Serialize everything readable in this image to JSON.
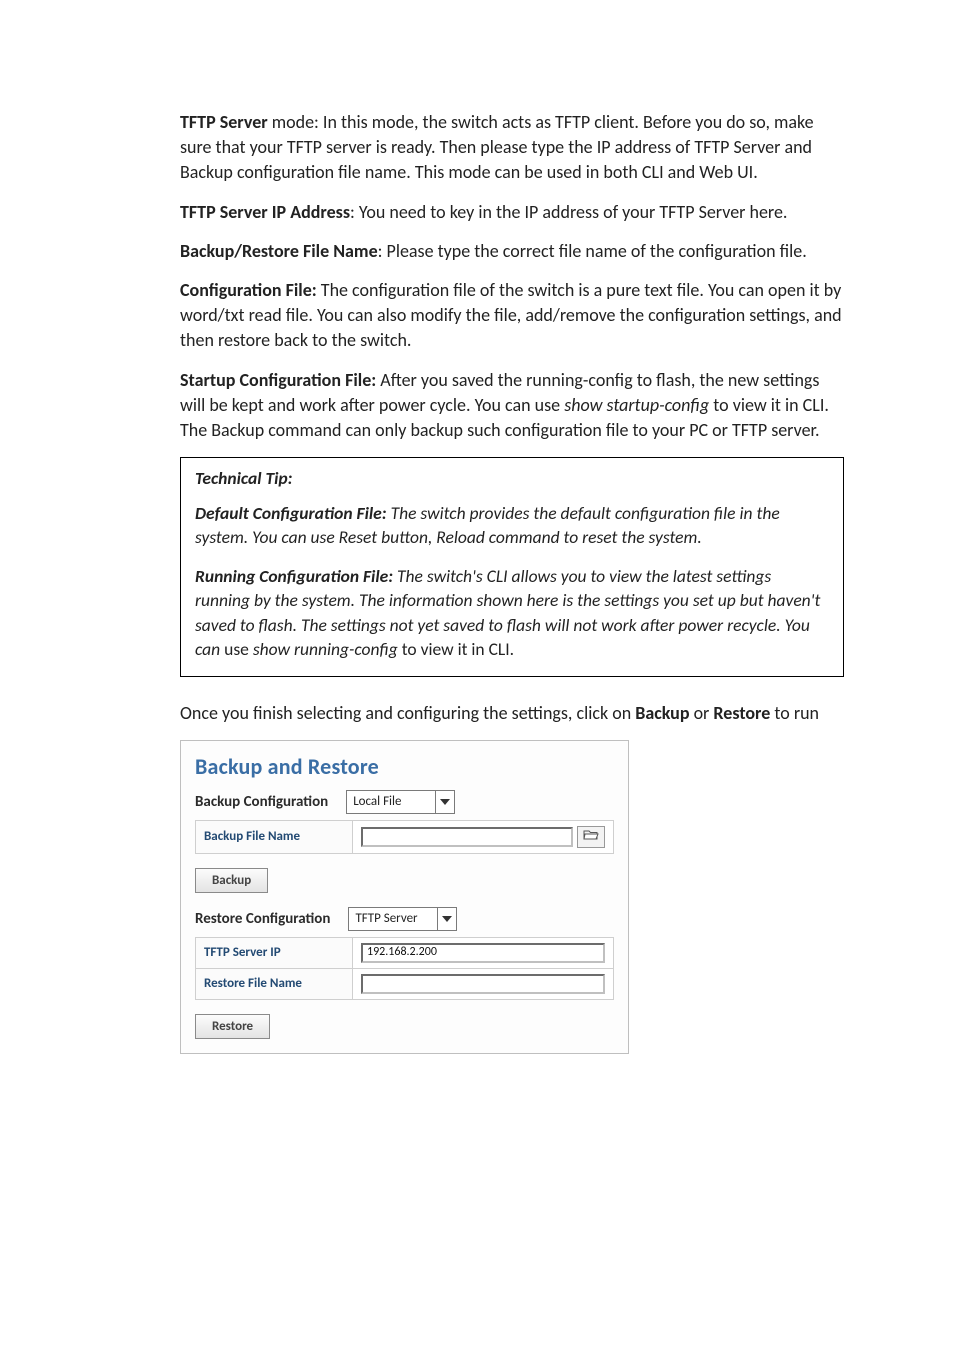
{
  "paragraphs": {
    "p1": {
      "lead": "TFTP Server",
      "rest": " mode: In this mode, the switch acts as TFTP client. Before you do so, make sure that your TFTP server is ready. Then please type the IP address of TFTP Server and Backup configuration file name. This mode can be used in both CLI and Web UI."
    },
    "p2": {
      "lead": "TFTP Server IP Address",
      "rest": ": You need to key in the IP address of your TFTP Server here."
    },
    "p3": {
      "lead": "Backup/Restore File Name",
      "rest": ": Please type the correct file name of the configuration file."
    },
    "p4": {
      "lead": "Configuration File:",
      "rest": " The configuration file of the switch is a pure text file. You can open it by word/txt read file. You can also modify the file, add/remove the configuration settings, and then restore back to the switch."
    },
    "p5": {
      "lead": "Startup Configuration File:",
      "rest1": " After you saved the running-config to flash, the new settings will be kept and work after power cycle. You can use ",
      "italic": "show startup-config",
      "rest2": " to view it in CLI. The Backup command can only backup such configuration file to your PC or TFTP server."
    }
  },
  "tip": {
    "title": "Technical Tip:",
    "p1": {
      "lead": "Default Configuration File:",
      "rest": " The switch provides the default configuration file in the system. You can use Reset button, Reload command to reset the system."
    },
    "p2": {
      "lead": "Running Configuration File:",
      "rest1": " The switch's CLI allows you to view the latest settings running by the system. The information shown here is the settings you set up but haven't saved to flash. The settings not yet saved to flash will not work after power recycle. You can ",
      "nonitalic1": "use ",
      "italic2": "show running-config",
      "nonitalic2": " to view it in CLI."
    }
  },
  "outro": {
    "pre": "Once you finish selecting and configuring the settings, click on ",
    "b1": "Backup",
    "mid": " or ",
    "b2": "Restore",
    "post": " to run"
  },
  "screenshot": {
    "title": "Backup and Restore",
    "backup": {
      "section_title": "Backup Configuration",
      "mode_selected": "Local File",
      "file_label": "Backup File Name",
      "file_value": "",
      "button": "Backup"
    },
    "restore": {
      "section_title": "Restore Configuration",
      "mode_selected": "TFTP Server",
      "ip_label": "TFTP Server IP",
      "ip_value": "192.168.2.200",
      "file_label": "Restore File Name",
      "file_value": "",
      "button": "Restore"
    }
  }
}
